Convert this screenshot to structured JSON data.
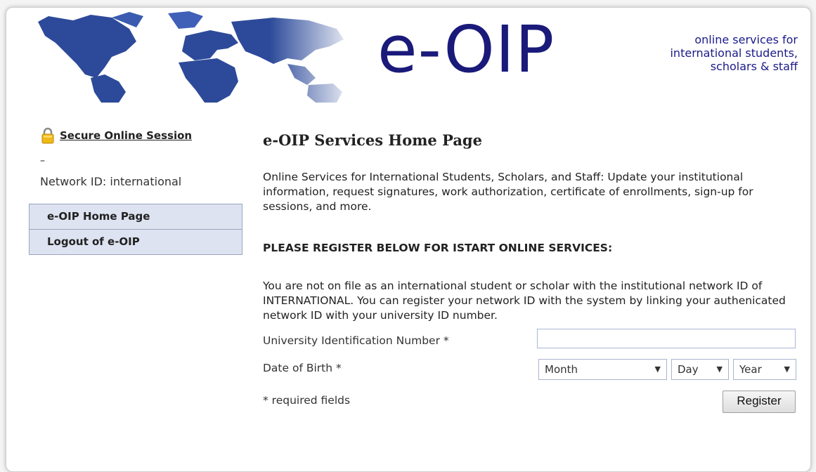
{
  "header": {
    "logo_text": "e-OIP",
    "tagline": [
      "online services for",
      "international students,",
      "scholars & staff"
    ]
  },
  "sidebar": {
    "secure_session": "Secure Online Session",
    "dash": "–",
    "network_id": "Network ID: international",
    "items": [
      {
        "label": "e-OIP Home Page"
      },
      {
        "label": "Logout of e-OIP"
      }
    ]
  },
  "main": {
    "title": "e-OIP Services Home Page",
    "intro": "Online Services for International Students, Scholars, and Staff: Update your institutional information, request signatures, work authorization, certificate of enrollments, sign-up for sessions, and more.",
    "heading": "PLEASE REGISTER BELOW FOR ISTART ONLINE SERVICES:",
    "notice": "You are not on file as an international student or scholar with the institutional network ID of INTERNATIONAL. You can register your network ID with the system by linking your authenicated network ID with your university ID number."
  },
  "form": {
    "uid_label": "University Identification Number *",
    "uid_value": "",
    "dob_label": "Date of Birth *",
    "month": "Month",
    "day": "Day",
    "year": "Year",
    "required_note": "* required fields",
    "register_label": "Register"
  },
  "icons": {
    "lock": "lock-icon",
    "dropdown": "chevron-down-icon"
  },
  "colors": {
    "logo": "#1a1a7a",
    "nav_bg": "#dde3f0",
    "map": "#2d4a9a"
  }
}
